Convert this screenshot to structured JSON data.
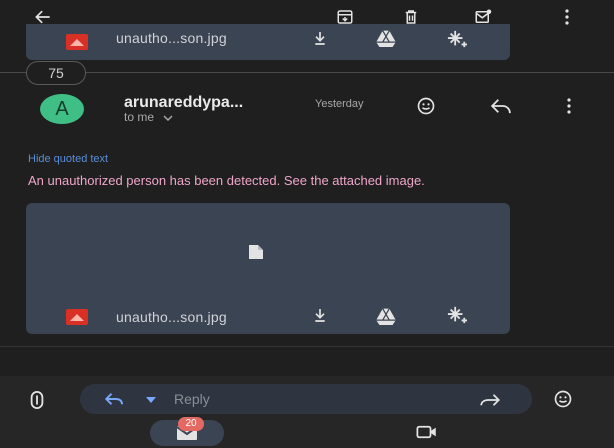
{
  "toolbar": {
    "back_icon": "arrow-left-icon",
    "archive_icon": "archive-icon",
    "delete_icon": "trash-icon",
    "mark_unread_icon": "mail-unread-icon",
    "more_icon": "more-vert-icon"
  },
  "attachments": [
    {
      "file_name": "unautho...son.jpg"
    },
    {
      "file_name": "unautho...son.jpg"
    }
  ],
  "thread": {
    "hidden_count": "75"
  },
  "message": {
    "avatar_letter": "A",
    "sender": "arunareddypa...",
    "time": "Yesterday",
    "recipient": "to me",
    "hide_quoted": "Hide quoted text",
    "body": "An unauthorized person has been detected. See the attached image."
  },
  "reply_bar": {
    "placeholder": "Reply"
  },
  "bottom_nav": {
    "mail_badge": "20"
  },
  "colors": {
    "background": "#1f1f1f",
    "attachment_card": "#3b4452",
    "avatar": "#3fbf86",
    "link": "#5a8ed8",
    "body_text": "#f0a5c8",
    "image_badge": "#d93025"
  }
}
